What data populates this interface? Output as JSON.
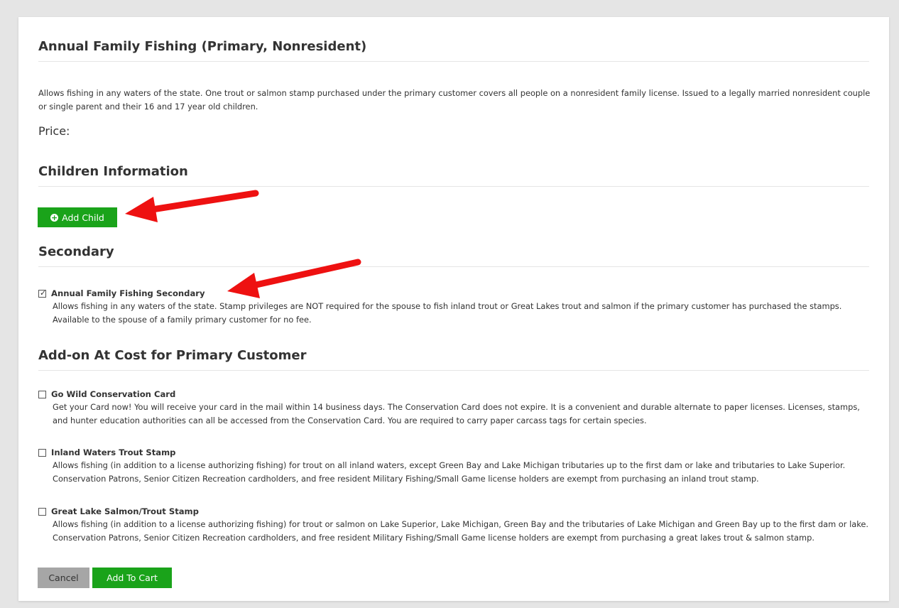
{
  "product": {
    "title": "Annual Family Fishing (Primary, Nonresident)",
    "description": "Allows fishing in any waters of the state. One trout or salmon stamp purchased under the primary customer covers all people on a nonresident family license. Issued to a legally married nonresident couple or single parent and their 16 and 17 year old children.",
    "price_label": "Price:"
  },
  "children": {
    "title": "Children Information",
    "add_child_label": "Add Child",
    "add_icon": "plus-circle-icon"
  },
  "secondary": {
    "title": "Secondary",
    "item": {
      "label": "Annual Family Fishing Secondary",
      "checked": true,
      "description": "Allows fishing in any waters of the state. Stamp privileges are NOT required for the spouse to fish inland trout or Great Lakes trout and salmon if the primary customer has purchased the stamps. Available to the spouse of a family primary customer for no fee."
    }
  },
  "addons": {
    "title": "Add-on At Cost for Primary Customer",
    "items": [
      {
        "label": "Go Wild Conservation Card",
        "checked": false,
        "description": "Get your Card now! You will receive your card in the mail within 14 business days. The Conservation Card does not expire. It is a convenient and durable alternate to paper licenses. Licenses, stamps, and hunter education authorities can all be accessed from the Conservation Card. You are required to carry paper carcass tags for certain species."
      },
      {
        "label": "Inland Waters Trout Stamp",
        "checked": false,
        "description": "Allows fishing (in addition to a license authorizing fishing) for trout on all inland waters, except Green Bay and Lake Michigan tributaries up to the first dam or lake and tributaries to Lake Superior. Conservation Patrons, Senior Citizen Recreation cardholders, and free resident Military Fishing/Small Game license holders are exempt from purchasing an inland trout stamp."
      },
      {
        "label": "Great Lake Salmon/Trout Stamp",
        "checked": false,
        "description": "Allows fishing (in addition to a license authorizing fishing) for trout or salmon on Lake Superior, Lake Michigan, Green Bay and the tributaries of Lake Michigan and Green Bay up to the first dam or lake. Conservation Patrons, Senior Citizen Recreation cardholders, and free resident Military Fishing/Small Game license holders are exempt from purchasing a great lakes trout & salmon stamp."
      }
    ]
  },
  "actions": {
    "cancel_label": "Cancel",
    "add_to_cart_label": "Add To Cart"
  },
  "colors": {
    "button_green": "#1aa31a",
    "button_gray": "#a6a6a6",
    "arrow_red": "#ee1111"
  }
}
